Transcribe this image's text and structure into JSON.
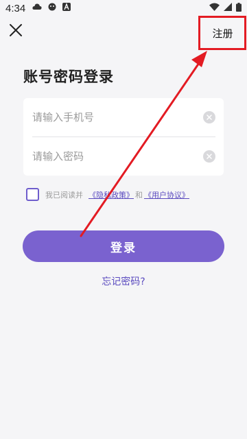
{
  "status_bar": {
    "time": "4:34",
    "icons_left": [
      "cloud-icon",
      "face-icon",
      "app-a-icon"
    ],
    "icons_right": [
      "wifi-icon",
      "signal-icon",
      "battery-icon"
    ]
  },
  "header": {
    "close_icon": "close-icon",
    "register_label": "注册"
  },
  "page": {
    "title": "账号密码登录"
  },
  "form": {
    "phone_placeholder": "请输入手机号",
    "phone_value": "",
    "password_placeholder": "请输入密码",
    "password_value": ""
  },
  "agreement": {
    "text": "我已阅读并",
    "privacy_link": "《隐私政策》",
    "and_text": "和",
    "user_link": "《用户协议》",
    "checked": false
  },
  "actions": {
    "login_label": "登录",
    "forgot_label": "忘记密码?"
  },
  "colors": {
    "accent": "#7a62cf",
    "link": "#5a4abf",
    "annotation": "#e31b23",
    "background": "#f5f5f7"
  }
}
